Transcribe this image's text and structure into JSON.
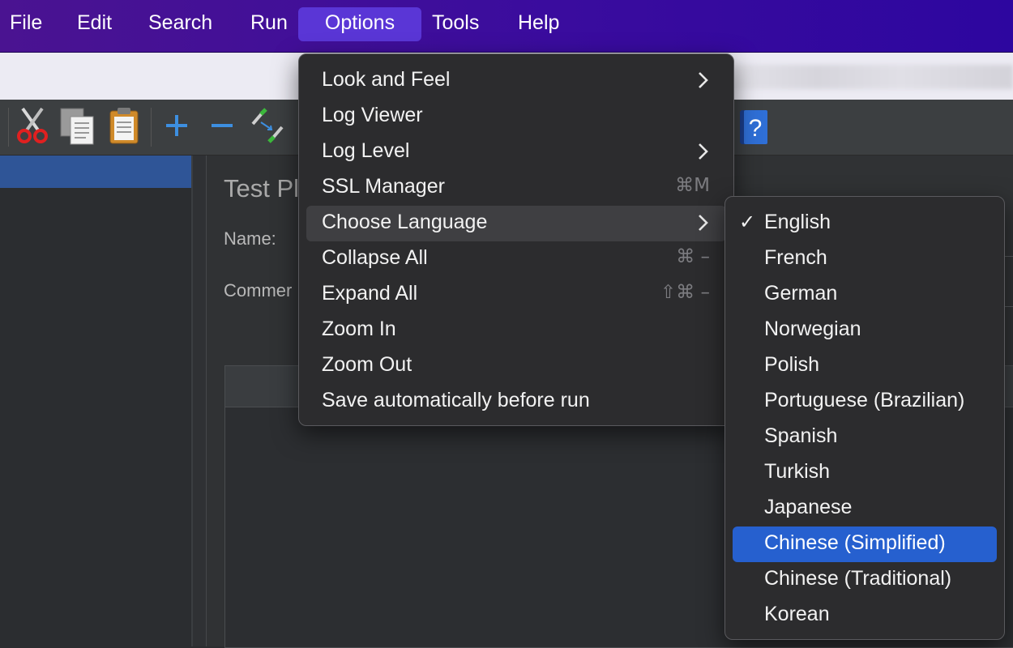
{
  "menubar": {
    "items": [
      "File",
      "Edit",
      "Search",
      "Run",
      "Options",
      "Tools",
      "Help"
    ],
    "active": "Options"
  },
  "main": {
    "title": "Test Pl",
    "name_label": "Name:",
    "comment_label": "Commer"
  },
  "options_menu": {
    "items": [
      {
        "label": "Look and Feel",
        "submenu": true,
        "shortcut": ""
      },
      {
        "label": "Log Viewer",
        "submenu": false,
        "shortcut": ""
      },
      {
        "label": "Log Level",
        "submenu": true,
        "shortcut": ""
      },
      {
        "label": "SSL Manager",
        "submenu": false,
        "shortcut": "⌘M"
      },
      {
        "label": "Choose Language",
        "submenu": true,
        "shortcut": "",
        "highlighted": true
      },
      {
        "label": "Collapse All",
        "submenu": false,
        "shortcut": "⌘ –"
      },
      {
        "label": "Expand All",
        "submenu": false,
        "shortcut": "⇧⌘ –"
      },
      {
        "label": "Zoom In",
        "submenu": false,
        "shortcut": ""
      },
      {
        "label": "Zoom Out",
        "submenu": false,
        "shortcut": ""
      },
      {
        "label": "Save automatically before run",
        "submenu": false,
        "shortcut": ""
      }
    ]
  },
  "language_menu": {
    "checkmark": "✓",
    "items": [
      {
        "label": "English",
        "checked": true
      },
      {
        "label": "French"
      },
      {
        "label": "German"
      },
      {
        "label": "Norwegian"
      },
      {
        "label": "Polish"
      },
      {
        "label": "Portuguese (Brazilian)"
      },
      {
        "label": "Spanish"
      },
      {
        "label": "Turkish"
      },
      {
        "label": "Japanese"
      },
      {
        "label": "Chinese (Simplified)",
        "selected": true
      },
      {
        "label": "Chinese (Traditional)"
      },
      {
        "label": "Korean"
      }
    ]
  },
  "toolbar": {
    "icons": [
      "cut-icon",
      "copy-icon",
      "paste-icon",
      "expand-icon",
      "collapse-icon",
      "toggle-icon",
      "help-icon"
    ],
    "help_glyph": "?"
  },
  "colors": {
    "menubar_start": "#4a1391",
    "menubar_end": "#2d069f",
    "active_menu": "#5a36d6",
    "selection_blue": "#2660cf",
    "tree_selection": "#2f5597"
  }
}
